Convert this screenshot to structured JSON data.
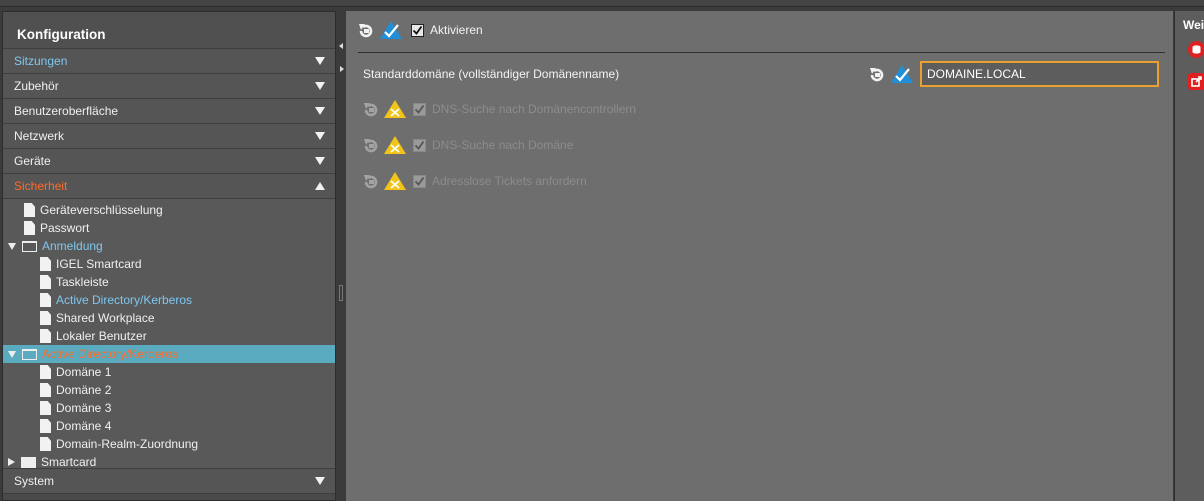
{
  "left_panel": {
    "title": "Konfiguration",
    "sections_top": [
      {
        "label": "Sitzungen",
        "color": "blue"
      },
      {
        "label": "Zubehör",
        "color": "white"
      },
      {
        "label": "Benutzeroberfläche",
        "color": "white"
      },
      {
        "label": "Netzwerk",
        "color": "white"
      },
      {
        "label": "Geräte",
        "color": "white"
      },
      {
        "label": "Sicherheit",
        "color": "orange"
      }
    ],
    "tree": [
      {
        "label": "Geräteverschlüsselung"
      },
      {
        "label": "Passwort"
      },
      {
        "label": "Anmeldung"
      },
      {
        "label": "IGEL Smartcard"
      },
      {
        "label": "Taskleiste"
      },
      {
        "label": "Active Directory/Kerberos"
      },
      {
        "label": "Shared Workplace"
      },
      {
        "label": "Lokaler Benutzer"
      },
      {
        "label": "Active Directory/Kerberos"
      },
      {
        "label": "Domäne 1"
      },
      {
        "label": "Domäne 2"
      },
      {
        "label": "Domäne 3"
      },
      {
        "label": "Domäne 4"
      },
      {
        "label": "Domain-Realm-Zuordnung"
      },
      {
        "label": "Smartcard"
      }
    ],
    "bottom_section": {
      "label": "System"
    }
  },
  "main": {
    "activate_label": "Aktivieren",
    "default_domain_label": "Standarddomäne (vollständiger Domänenname)",
    "default_domain_value": "DOMAINE.LOCAL",
    "options": [
      {
        "label": "DNS-Suche nach Domänencontrollern",
        "checked": true
      },
      {
        "label": "DNS-Suche nach Domäne",
        "checked": true
      },
      {
        "label": "Adresslose Tickets anfordern",
        "checked": true
      }
    ]
  },
  "right_panel": {
    "title": "Weitere"
  },
  "colors": {
    "accent_blue": "#7ec7f0",
    "accent_orange": "#ff6b2a",
    "selection": "#5aabc0",
    "input_border": "#e8a02e"
  }
}
